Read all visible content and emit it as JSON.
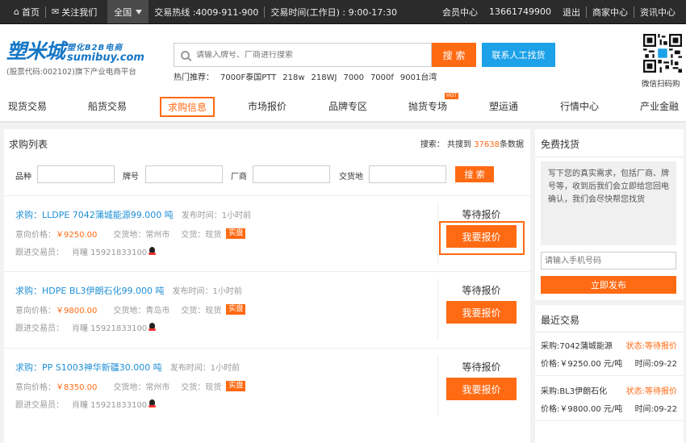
{
  "topbar": {
    "home": "首页",
    "follow": "关注我们",
    "region": "全国",
    "hotline": "交易热线 :4009-911-900",
    "hours": "交易时间(工作日) : 9:00-17:30",
    "member_center": "会员中心",
    "phone": "13661749900",
    "logout": "退出",
    "merchant_center": "商家中心",
    "news_center": "资讯中心"
  },
  "header": {
    "logo_main": "塑米城",
    "logo_side_top": "塑化B2B电商",
    "logo_side_bottom": "sumibuy.com",
    "logo_sub": "(股票代码:002102)旗下产业电商平台",
    "search_placeholder": "请输入牌号、厂商进行搜索",
    "search_button": "搜 索",
    "contact_button": "联系人工找货",
    "hot_label": "热门推荐：",
    "hot_items": [
      "7000F泰国PTT",
      "218w",
      "218WJ",
      "7000",
      "7000f",
      "9001台湾"
    ],
    "qr_label": "微信扫码购"
  },
  "nav": {
    "items": [
      "现货交易",
      "船货交易",
      "求购信息",
      "市场报价",
      "品牌专区",
      "抛货专场",
      "塑运通",
      "行情中心",
      "产业金融"
    ],
    "hot_badge": "HOT",
    "active_index": 2
  },
  "main": {
    "title": "求购列表",
    "count_prefix": "搜索： 共搜到",
    "count_value": "37638",
    "count_suffix": "条数据",
    "filters": {
      "grade_label": "品种",
      "brand_label": "牌号",
      "maker_label": "厂商",
      "place_label": "交货地",
      "button": "搜 索"
    },
    "items": [
      {
        "title": "求购：LLDPE 7042蒲城能源99.000 吨",
        "time": "发布时间：1小时前",
        "price_label": "意向价格：",
        "price": "￥9250.00",
        "place": "交货地：常州市",
        "delivery": "交货：现货",
        "badge": "实盘",
        "trader_label": "跟进交易员：",
        "trader": "肖瞳 15921833100",
        "status": "等待报价",
        "button": "我要报价"
      },
      {
        "title": "求购：HDPE BL3伊朗石化99.000 吨",
        "time": "发布时间：1小时前",
        "price_label": "意向价格：",
        "price": "￥9800.00",
        "place": "交货地：青岛市",
        "delivery": "交货：现货",
        "badge": "实盘",
        "trader_label": "跟进交易员：",
        "trader": "肖瞳 15921833100",
        "status": "等待报价",
        "button": "我要报价"
      },
      {
        "title": "求购：PP S1003神华新疆30.000 吨",
        "time": "发布时间：1小时前",
        "price_label": "意向价格：",
        "price": "￥8350.00",
        "place": "交货地：常州市",
        "delivery": "交货：现货",
        "badge": "实盘",
        "trader_label": "跟进交易员：",
        "trader": "肖瞳 15921833100",
        "status": "等待报价",
        "button": "我要报价"
      }
    ]
  },
  "side_find": {
    "title": "免费找货",
    "note": "写下您的真实需求，包括厂商、牌号等，收到后我们会立即给您回电确认，我们会尽快帮您找货",
    "phone_placeholder": "请输入手机号码",
    "button": "立即发布"
  },
  "side_recent": {
    "title": "最近交易",
    "items": [
      {
        "name": "采购:7042蒲城能源",
        "status": "状态:等待报价",
        "price": "价格:￥9250.00 元/吨",
        "time": "时间:09-22"
      },
      {
        "name": "采购:BL3伊朗石化",
        "status": "状态:等待报价",
        "price": "价格:￥9800.00 元/吨",
        "time": "时间:09-22"
      }
    ]
  },
  "colors": {
    "accent": "#ff6a13",
    "link": "#1e8fd6",
    "contact": "#1da1e8",
    "brand": "#1677c6"
  }
}
